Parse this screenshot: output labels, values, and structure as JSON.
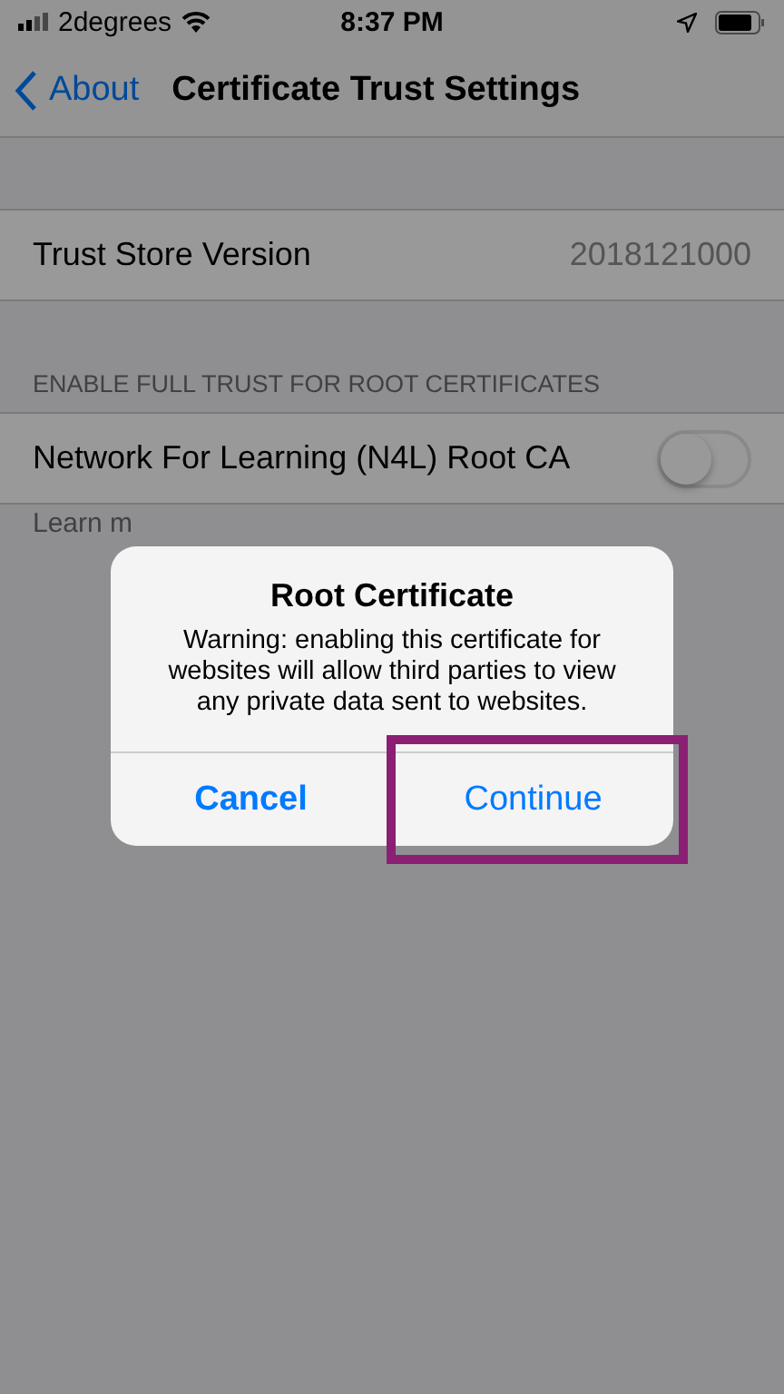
{
  "status_bar": {
    "carrier": "2degrees",
    "time": "8:37 PM"
  },
  "nav": {
    "back_label": "About",
    "title": "Certificate Trust Settings"
  },
  "version_row": {
    "label": "Trust Store Version",
    "value": "2018121000"
  },
  "section": {
    "header": "ENABLE FULL TRUST FOR ROOT CERTIFICATES",
    "rows": [
      {
        "label": "Network For Learning (N4L) Root CA",
        "on": false
      }
    ],
    "footer": "Learn m"
  },
  "alert": {
    "title": "Root Certificate",
    "message": "Warning: enabling this certificate for websites will allow third parties to view any private data sent to websites.",
    "buttons": [
      {
        "label": "Cancel",
        "kind": "cancel",
        "highlighted": false
      },
      {
        "label": "Continue",
        "kind": "default",
        "highlighted": true
      }
    ]
  }
}
